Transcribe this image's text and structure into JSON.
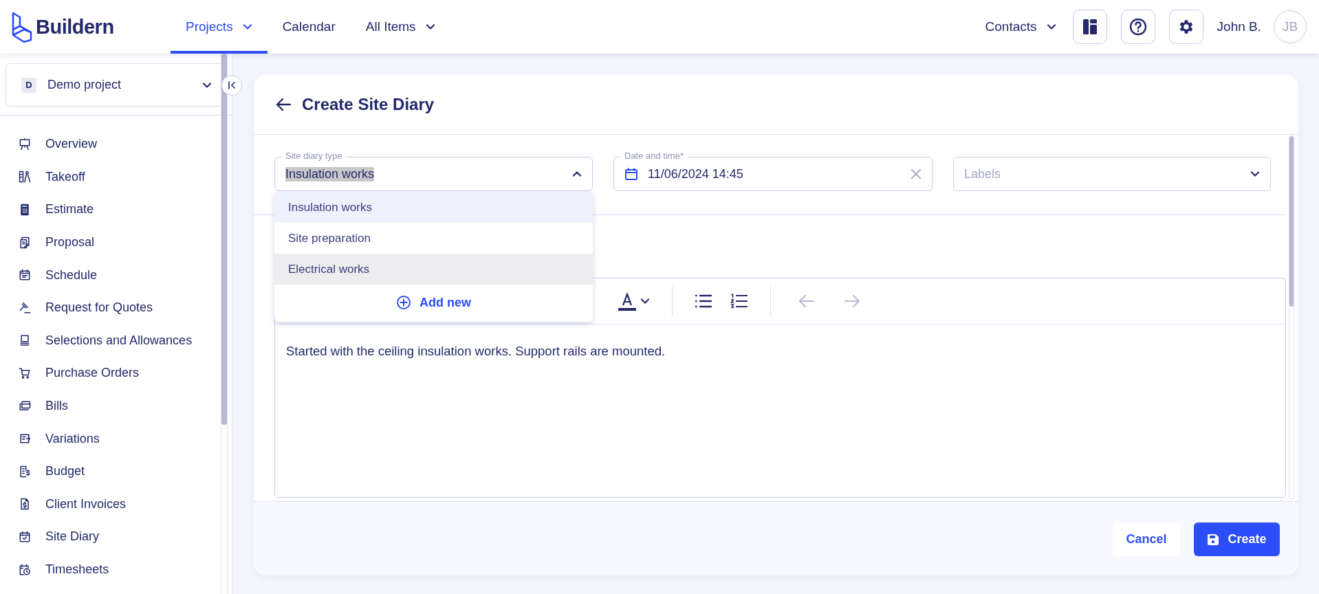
{
  "header": {
    "logo": "Buildern",
    "nav": [
      {
        "label": "Projects",
        "selected": true,
        "caret": true
      },
      {
        "label": "Calendar",
        "selected": false,
        "caret": false
      },
      {
        "label": "All Items",
        "selected": false,
        "caret": true
      }
    ],
    "contacts": "Contacts",
    "user_name": "John B.",
    "avatar_initials": "JB"
  },
  "sidebar": {
    "project": {
      "badge": "D",
      "name": "Demo project"
    },
    "items": [
      {
        "label": "Overview"
      },
      {
        "label": "Takeoff"
      },
      {
        "label": "Estimate"
      },
      {
        "label": "Proposal"
      },
      {
        "label": "Schedule"
      },
      {
        "label": "Request for Quotes"
      },
      {
        "label": "Selections and Allowances"
      },
      {
        "label": "Purchase Orders"
      },
      {
        "label": "Bills"
      },
      {
        "label": "Variations"
      },
      {
        "label": "Budget"
      },
      {
        "label": "Client Invoices"
      },
      {
        "label": "Site Diary"
      },
      {
        "label": "Timesheets"
      }
    ]
  },
  "form": {
    "title": "Create Site Diary",
    "type_field": {
      "label": "Site diary type",
      "value": "Insulation works",
      "expanded": true,
      "options": [
        {
          "label": "Insulation works",
          "selected": true,
          "hovered": false
        },
        {
          "label": "Site preparation",
          "selected": false,
          "hovered": false
        },
        {
          "label": "Electrical works",
          "selected": false,
          "hovered": true
        }
      ],
      "add_new": "Add new"
    },
    "date_field": {
      "label": "Date and time*",
      "value": "11/06/2024 14:45"
    },
    "labels_field": {
      "placeholder": "Labels"
    },
    "editor": {
      "toolbar": [
        {
          "kind": "text-color",
          "disabled": false
        },
        {
          "kind": "bullet-list",
          "disabled": false
        },
        {
          "kind": "numbered-list",
          "disabled": false
        },
        {
          "kind": "undo",
          "disabled": true
        },
        {
          "kind": "redo",
          "disabled": true
        }
      ],
      "text": "Started with the ceiling insulation works. Support rails are mounted."
    },
    "buttons": {
      "cancel": "Cancel",
      "create": "Create"
    }
  }
}
